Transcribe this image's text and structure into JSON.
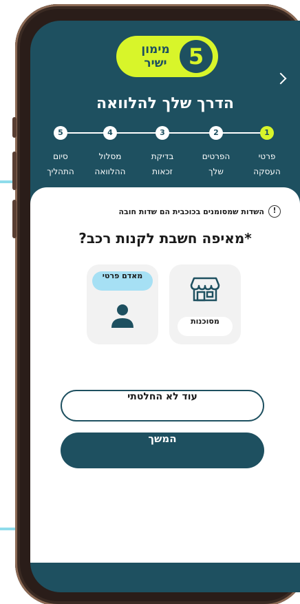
{
  "header": {
    "logo_number": "5",
    "logo_line1": "מימון",
    "logo_line2": "ישיר",
    "title": "הדרך שלך להלוואה"
  },
  "steps": [
    {
      "number": "1",
      "line1": "פרטי",
      "line2": "העסקה",
      "active": true
    },
    {
      "number": "2",
      "line1": "הפרטים",
      "line2": "שלך",
      "active": false
    },
    {
      "number": "3",
      "line1": "בדיקת",
      "line2": "זכאות",
      "active": false
    },
    {
      "number": "4",
      "line1": "מסלול",
      "line2": "ההלוואה",
      "active": false
    },
    {
      "number": "5",
      "line1": "סיום",
      "line2": "התהליך",
      "active": false
    }
  ],
  "form": {
    "note": "השדות שמסומנים בכוכבית הם שדות חובה",
    "question": "*מאיפה חשבת לקנות רכב?",
    "options": {
      "dealer": {
        "label": "מסוכנות",
        "icon": "store-icon"
      },
      "private": {
        "label": "מאדם פרטי",
        "icon": "person-icon"
      }
    },
    "undecided_label": "עוד לא החלטתי",
    "continue_label": "המשך"
  },
  "colors": {
    "primary": "#1e5060",
    "accent": "#d8f52a",
    "tag": "#a6e0f4"
  }
}
